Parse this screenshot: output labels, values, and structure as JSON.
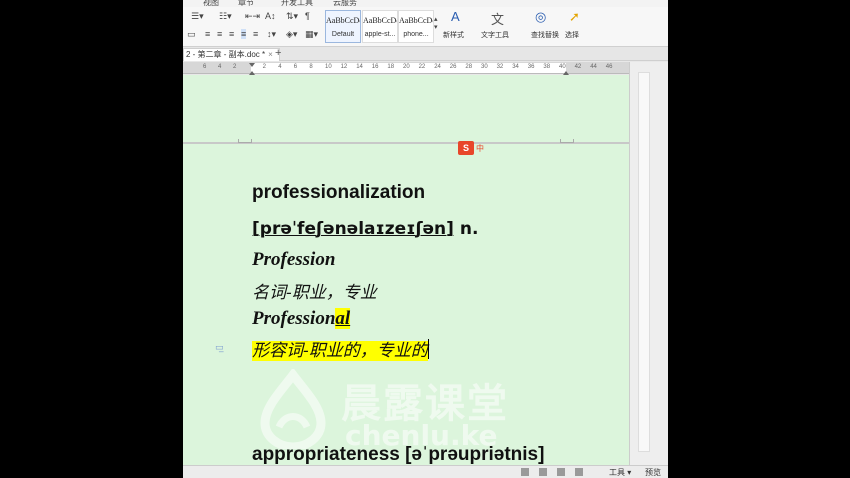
{
  "menu": {
    "tabs": [
      "视图",
      "章节",
      "开发工具",
      "云服务"
    ]
  },
  "ribbon": {
    "styles": [
      {
        "sample": "AaBbCcDd",
        "name": "Default",
        "selected": true
      },
      {
        "sample": "AaBbCcDd",
        "name": "apple-st..."
      },
      {
        "sample": "AaBbCcDd",
        "name": "phone..."
      }
    ],
    "new_style_label": "新样式",
    "text_tools_label": "文字工具",
    "find_label": "查找替换",
    "select_label": "选择"
  },
  "tab": {
    "label": "2 - 第二章 - 副本.doc *",
    "close": "×",
    "add": "+"
  },
  "ruler": {
    "numbers": [
      "6",
      "4",
      "2",
      "2",
      "4",
      "6",
      "8",
      "10",
      "12",
      "14",
      "16",
      "18",
      "20",
      "22",
      "24",
      "26",
      "28",
      "30",
      "32",
      "34",
      "36",
      "38",
      "40",
      "42",
      "44",
      "46"
    ]
  },
  "document": {
    "headword": "professionalization",
    "ipa": "[prəˈfeʃənəlaɪzeɪʃən]",
    "pos": " n.",
    "word1": "Profession",
    "meaning1": "名词-职业，专业",
    "word2_root": "Profession",
    "word2_suffix": "al",
    "meaning2": "形容词-职业的，专业的",
    "headword2": "appropriateness [əˈprəupriətnis]"
  },
  "watermark": {
    "cn": "晨露课堂",
    "en": "chenlu.ke"
  },
  "sogou": {
    "logo": "S",
    "label": "中"
  },
  "status": {
    "tools": "工具",
    "preview": "预览"
  }
}
